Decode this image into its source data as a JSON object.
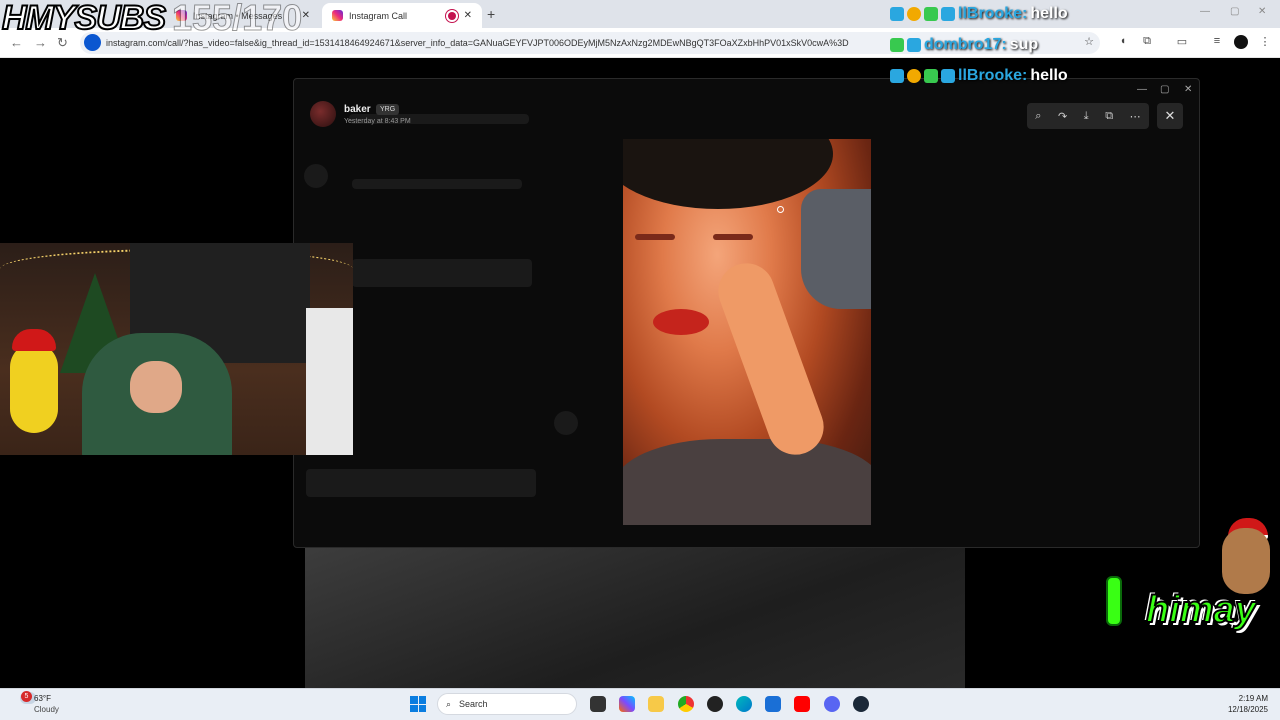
{
  "browser": {
    "tabs": [
      {
        "label": "Instagram • Messages"
      },
      {
        "label": "Instagram Call"
      }
    ],
    "url": "instagram.com/call/?has_video=false&ig_thread_id=1531418464924671&server_info_data=GANuaGEYFVJPT006ODEyMjM5NzAxNzg2MDEwNBgQT3FOaXZxbHhPV01xSkV0cwA%3D"
  },
  "overlay": {
    "brand": "HMYSUBS",
    "sub_counter": "155/170",
    "streamer_tag": "himay",
    "chat": [
      {
        "user": "llBrooke:",
        "message": "hello"
      },
      {
        "user": "dombro17:",
        "message": "sup"
      },
      {
        "user": "llBrooke:",
        "message": "hello"
      }
    ]
  },
  "dm_window": {
    "sender_name": "baker",
    "badge": "YRG",
    "timestamp": "Yesterday at 8:43 PM"
  },
  "taskbar": {
    "weather_temp": "63°F",
    "weather_desc": "Cloudy",
    "weather_badge": "5",
    "search_placeholder": "Search",
    "time": "2:19 AM",
    "date": "12/18/2025"
  },
  "colors": {
    "accent_green": "#39ff14",
    "chat_name_blue": "#2aa7e0",
    "instagram_record": "#c4124f"
  }
}
